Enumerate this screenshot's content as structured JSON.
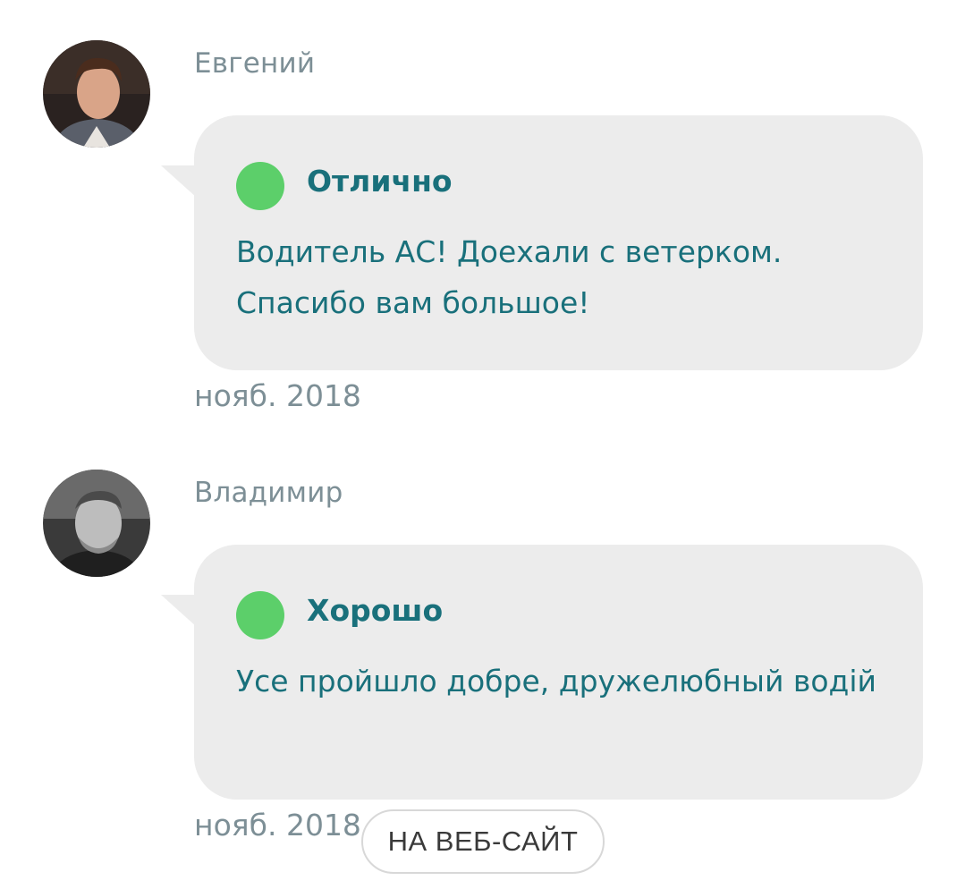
{
  "reviews": [
    {
      "author": "Евгений",
      "rating_label": "Отлично",
      "rating_color": "#5ccf6a",
      "text": "Водитель АС! Доехали с ветерком. Спасибо вам большое!",
      "date": "нояб. 2018"
    },
    {
      "author": "Владимир",
      "rating_label": "Хорошо",
      "rating_color": "#5ccf6a",
      "text": "Усе пройшло добре, дружелюбный водій",
      "date": "нояб. 2018"
    }
  ],
  "web_button": {
    "label": "НА ВЕБ-САЙТ"
  },
  "colors": {
    "accent_text": "#19707b",
    "muted_text": "#7d8f96",
    "bubble_bg": "#ececec"
  }
}
